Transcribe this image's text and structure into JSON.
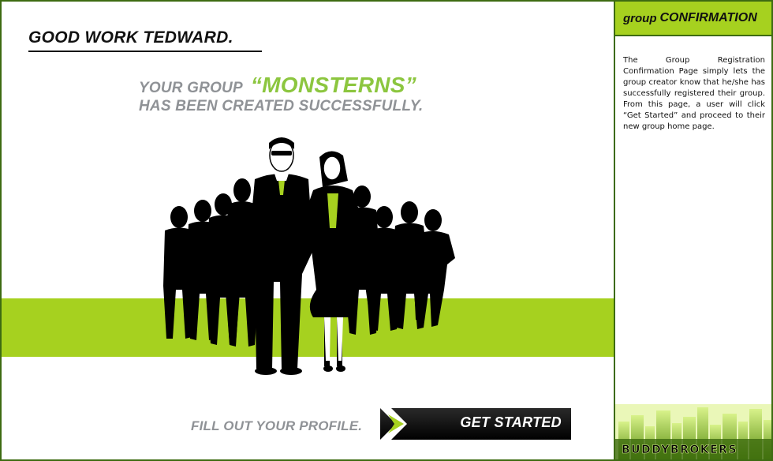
{
  "main": {
    "headline": "GOOD WORK TEDWARD.",
    "message_prefix": "YOUR GROUP",
    "group_name": "“MONSTERNS”",
    "message_line2": "HAS BEEN CREATED SUCCESSFULLY.",
    "cta_label": "FILL OUT YOUR PROFILE.",
    "cta_button": "GET STARTED"
  },
  "sidebar": {
    "title_lower": "group",
    "title_upper": "CONFIRMATION",
    "description": "The Group Registration Confirmation Page simply lets the group creator know that he/she has successfully registered their group. From this page, a user will click “Get Started” and proceed to their new group home page.",
    "brand": "BUDDYBROKERS"
  },
  "colors": {
    "accent": "#a6d11f",
    "accent_text": "#8cc63f",
    "frame": "#3d6b12",
    "muted_text": "#8f9296"
  }
}
